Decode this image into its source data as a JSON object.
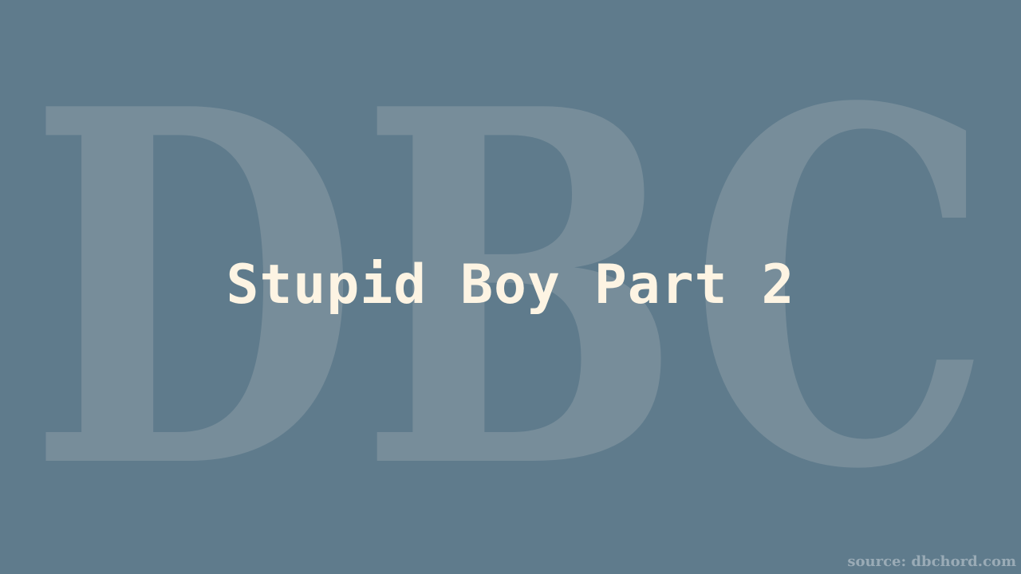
{
  "watermark": {
    "text": "DBC"
  },
  "title": "Stupid Boy Part 2",
  "source": "source: dbchord.com",
  "colors": {
    "background": "#5f7b8c",
    "watermark": "#778d9a",
    "title": "#fdf4e3",
    "source": "#9aabb6"
  }
}
